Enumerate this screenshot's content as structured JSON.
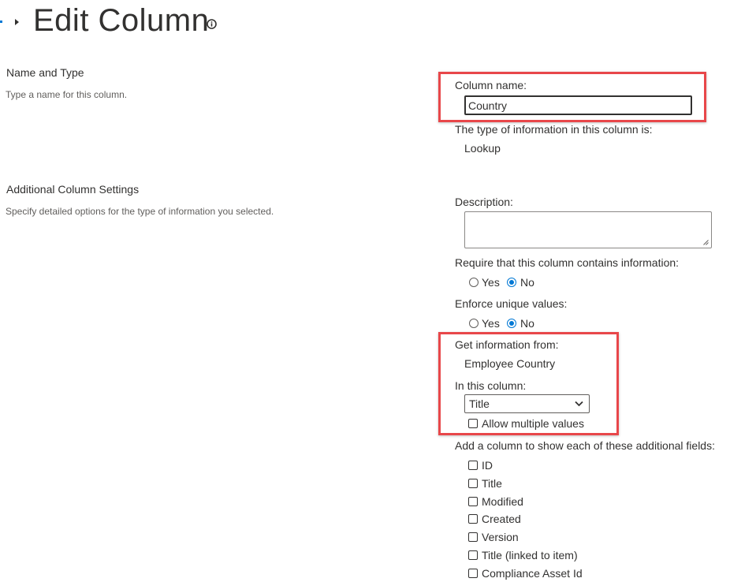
{
  "header": {
    "title": "Edit Column"
  },
  "sections": {
    "name_type": {
      "title": "Name and Type",
      "description": "Type a name for this column."
    },
    "additional": {
      "title": "Additional Column Settings",
      "description": "Specify detailed options for the type of information you selected."
    }
  },
  "column_name": {
    "label": "Column name:",
    "value": "Country"
  },
  "type_info": {
    "label": "The type of information in this column is:",
    "value": "Lookup"
  },
  "description": {
    "label": "Description:",
    "value": ""
  },
  "require": {
    "label": "Require that this column contains information:",
    "options": [
      "Yes",
      "No"
    ],
    "selected": "No"
  },
  "unique": {
    "label": "Enforce unique values:",
    "options": [
      "Yes",
      "No"
    ],
    "selected": "No"
  },
  "lookup": {
    "source_label": "Get information from:",
    "source_value": "Employee Country",
    "column_label": "In this column:",
    "column_value": "Title",
    "allow_multiple_label": "Allow multiple values",
    "allow_multiple_checked": false
  },
  "additional_fields": {
    "label": "Add a column to show each of these additional fields:",
    "items": [
      {
        "label": "ID",
        "checked": false
      },
      {
        "label": "Title",
        "checked": false
      },
      {
        "label": "Modified",
        "checked": false
      },
      {
        "label": "Created",
        "checked": false
      },
      {
        "label": "Version",
        "checked": false
      },
      {
        "label": "Title (linked to item)",
        "checked": false
      },
      {
        "label": "Compliance Asset Id",
        "checked": false
      }
    ]
  },
  "colors": {
    "accent": "#0078d4",
    "highlight": "#e8474a",
    "text": "#323130",
    "muted": "#605e5c"
  }
}
